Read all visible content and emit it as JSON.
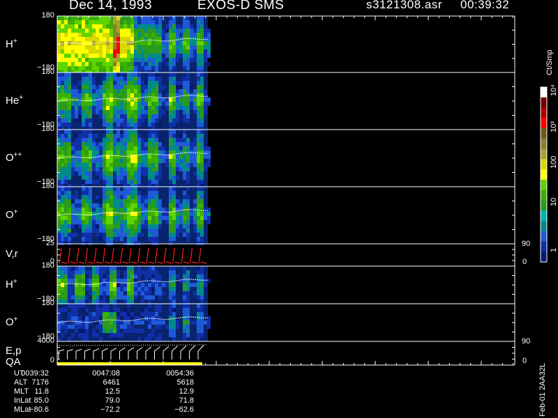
{
  "header": {
    "date": "Dec 14, 1993",
    "instrument": "EXOS-D SMS",
    "filename": "s3121308.asr",
    "time": "00:39:32"
  },
  "panels": [
    {
      "label": "H",
      "charge": "+",
      "ymax": "180",
      "ymin": "−180"
    },
    {
      "label": "He",
      "charge": "+",
      "ymax": "180",
      "ymin": "−180"
    },
    {
      "label": "O",
      "charge": "++",
      "ymax": "180",
      "ymin": "−180"
    },
    {
      "label": "O",
      "charge": "+",
      "ymax": "180",
      "ymin": "−180"
    },
    {
      "label": "V,r",
      "charge": "",
      "ymax": "25",
      "ymin": "0",
      "right_max": "90",
      "right_min": "0"
    },
    {
      "label": "H",
      "charge": "+",
      "ymax": "180",
      "ymin": "−180"
    },
    {
      "label": "O",
      "charge": "+",
      "ymax": "180",
      "ymin": "−180"
    },
    {
      "label": "E,p",
      "label2": "QA",
      "charge": "",
      "ymax": "4000",
      "ymin": "0",
      "right_max": "90",
      "right_min": "0"
    }
  ],
  "colorbar": {
    "unit": "Ct/Smp",
    "ticks": [
      "10⁴",
      "10³",
      "100",
      "10",
      "1"
    ],
    "colors": [
      "#ffffff",
      "#7a0000",
      "#b00000",
      "#ff0000",
      "#6b5a1c",
      "#8a7f2c",
      "#a6a031",
      "#d8d800",
      "#ffff00",
      "#5fd400",
      "#3cb000",
      "#2a9a1e",
      "#00b3b3",
      "#008b8b",
      "#1e5ad8",
      "#102fa8",
      "#061a70"
    ]
  },
  "chart_data": {
    "type": "heatmap",
    "title": "Dec 14, 1993 EXOS-D SMS",
    "panels": [
      "H+",
      "He+",
      "O++",
      "O+",
      "V,r",
      "H+",
      "O+",
      "E,p / QA"
    ],
    "x_ticks": [
      "0039:32",
      "0047:08",
      "0054:36"
    ],
    "x_rows": [
      {
        "name": "UT",
        "values": [
          "0039:32",
          "0047:08",
          "0054:36"
        ]
      },
      {
        "name": "ALT",
        "values": [
          "7176",
          "6461",
          "5618"
        ]
      },
      {
        "name": "MLT",
        "values": [
          "11.8",
          "12.5",
          "12.9"
        ]
      },
      {
        "name": "InLat",
        "values": [
          "85.0",
          "79.0",
          "71.8"
        ]
      },
      {
        "name": "MLat",
        "values": [
          "−80.6",
          "−72.2",
          "−62.6"
        ]
      }
    ],
    "y_range_pitch": [
      -180,
      180
    ],
    "colorbar_range": [
      1,
      10000
    ],
    "colorbar_scale": "log"
  },
  "side_label": "Feb-01 2AA32L"
}
